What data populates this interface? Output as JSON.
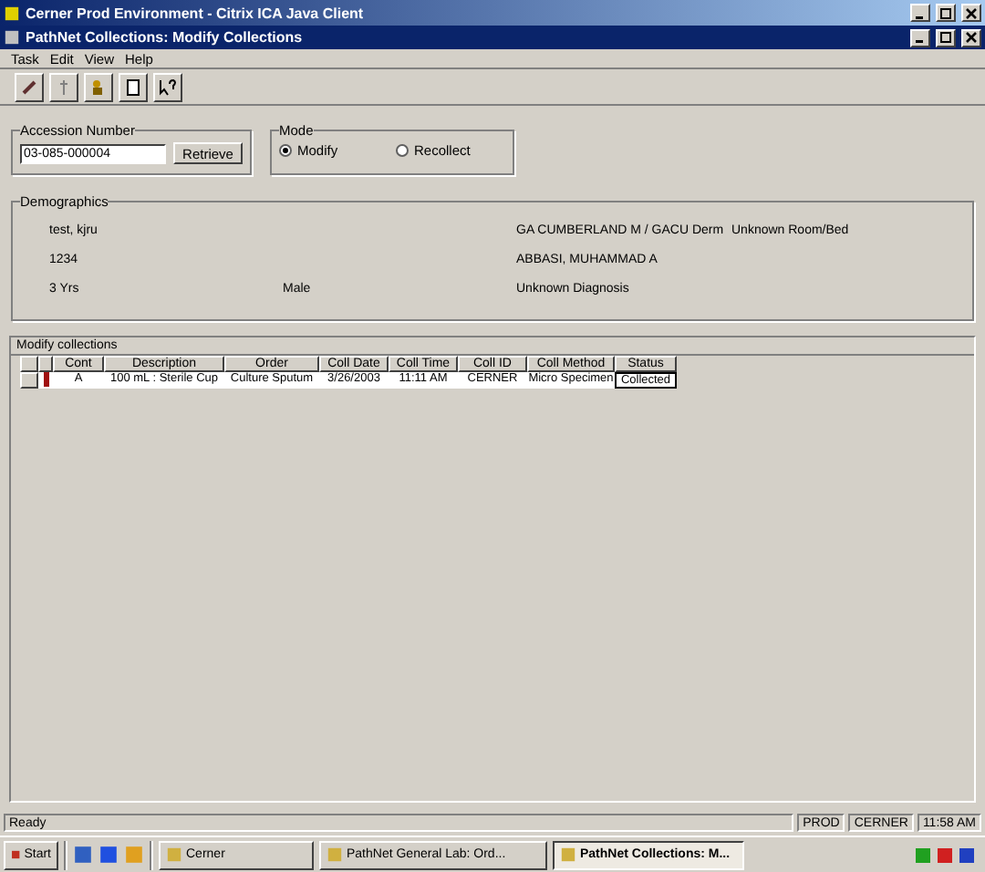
{
  "outer_window": {
    "title": "Cerner Prod Environment - Citrix ICA Java Client"
  },
  "window": {
    "title": "PathNet Collections: Modify Collections"
  },
  "menu": [
    {
      "label": "Task"
    },
    {
      "label": "Edit"
    },
    {
      "label": "View"
    },
    {
      "label": "Help"
    }
  ],
  "accession": {
    "label": "Accession Number",
    "value": "03-085-000004",
    "button": "Retrieve"
  },
  "mode": {
    "label": "Mode",
    "options": [
      {
        "label": "Modify",
        "selected": true
      },
      {
        "label": "Recollect",
        "selected": false
      }
    ]
  },
  "demographics": {
    "title": "Demographics",
    "rows": [
      [
        "test, kjru",
        "",
        "GA CUMBERLAND M / GACU Derm",
        "Unknown Room/Bed"
      ],
      [
        "1234",
        "",
        "ABBASI, MUHAMMAD A",
        ""
      ],
      [
        "3 Yrs",
        "Male",
        "Unknown Diagnosis",
        ""
      ]
    ]
  },
  "table": {
    "title": "Modify collections",
    "columns": [
      "Cont",
      "Description",
      "Order",
      "Coll Date",
      "Coll Time",
      "Coll ID",
      "Coll Method",
      "Status"
    ],
    "rows": [
      {
        "cells": [
          "A",
          "100 mL : Sterile Cup",
          "Culture Sputum",
          "3/26/2003",
          "11:11 AM",
          "CERNER",
          "Micro Specimen",
          "Collected"
        ]
      }
    ]
  },
  "status_bar": {
    "text": "Ready",
    "panels": [
      "PROD",
      "CERNER",
      "11:58 AM"
    ]
  },
  "taskbar": {
    "start": "Start",
    "tasks": [
      {
        "label": "Cerner",
        "selected": false
      },
      {
        "label": "PathNet General Lab: Ord...",
        "selected": false
      },
      {
        "label": "PathNet Collections: M...",
        "selected": true
      }
    ]
  }
}
